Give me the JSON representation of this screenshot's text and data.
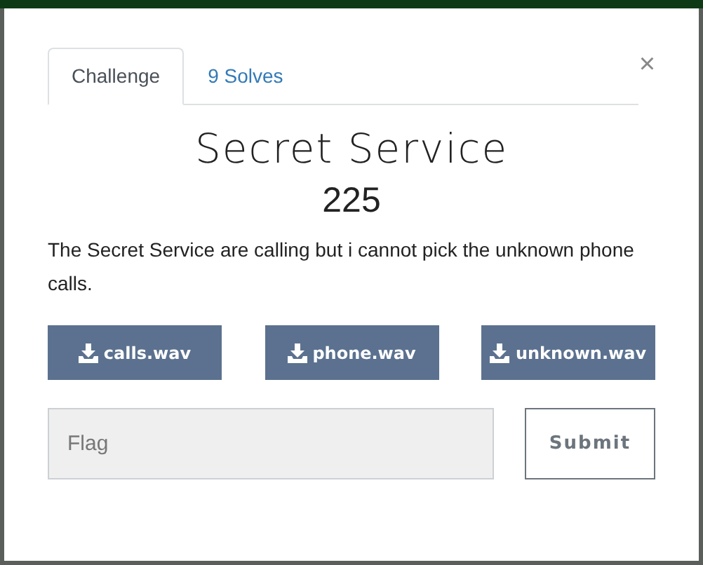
{
  "tabs": [
    {
      "label": "Challenge",
      "selected": true
    },
    {
      "label": "9 Solves",
      "selected": false
    }
  ],
  "close": "×",
  "challenge": {
    "name": "Secret Service",
    "value": "225",
    "description": "The Secret Service are calling but i cannot pick the unknown phone calls."
  },
  "files": [
    "calls.wav",
    "phone.wav",
    "unknown.wav"
  ],
  "flag": {
    "placeholder": "Flag"
  },
  "submit": "Submit"
}
